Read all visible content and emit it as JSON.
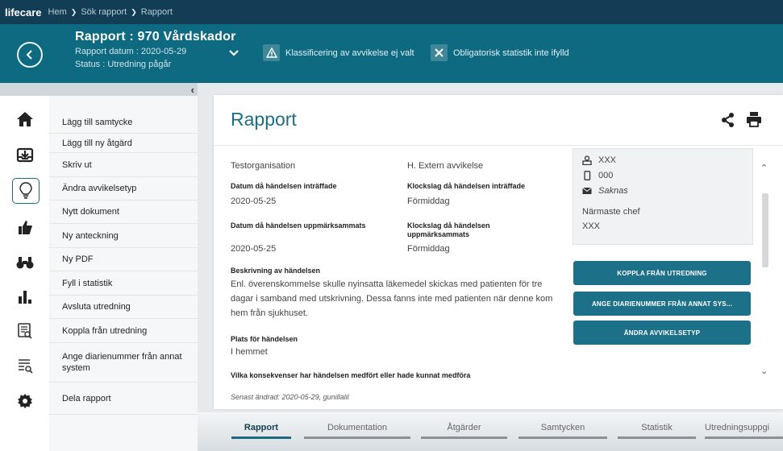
{
  "app": {
    "brand": "lifecare"
  },
  "breadcrumb": [
    "Hem",
    "Sök rapport",
    "Rapport"
  ],
  "header": {
    "title": "Rapport : 970 Vårdskador",
    "date_line": "Rapport datum : 2020-05-29",
    "status_line": "Status : Utredning pågår",
    "warnings": [
      "Klassificering av avvikelse ej valt",
      "Obligatorisk statistik inte ifylld"
    ]
  },
  "sidebar_icons": [
    "home-icon",
    "inbox-icon",
    "lightbulb-icon",
    "thumbs-up-icon",
    "binoculars-icon",
    "bar-chart-icon",
    "calendar-search-icon",
    "list-search-icon",
    "gear-icon"
  ],
  "menu": {
    "collapse_label": "‹",
    "items": [
      "Lägg till samtycke",
      "Lägg till ny åtgärd",
      "Skriv ut",
      "Ändra avvikelsetyp",
      "Nytt dokument",
      "Ny anteckning",
      "Ny PDF",
      "Fyll i statistik",
      "Avsluta utredning",
      "Koppla från utredning",
      "Ange diarienummer från annat system",
      "Dela rapport"
    ]
  },
  "report": {
    "title": "Rapport",
    "organisation": "Testorganisation",
    "category": "H. Extern avvikelse",
    "occurred_date_label": "Datum då händelsen inträffade",
    "occurred_date": "2020-05-25",
    "occurred_time_label": "Klockslag då händelsen inträffade",
    "occurred_time": "Förmiddag",
    "noticed_date_label": "Datum då händelsen uppmärksammats",
    "noticed_date": "2020-05-25",
    "noticed_time_label": "Klockslag då händelsen uppmärksammats",
    "noticed_time": "Förmiddag",
    "description_label": "Beskrivning av händelsen",
    "description": "Enl. överenskommelse skulle nyinsatta läkemedel skickas med patienten för tre dagar i samband med utskrivning.  Dessa fanns inte med patienten när denne kom hem från sjukhuset.",
    "place_label": "Plats för händelsen",
    "place": "I hemmet",
    "consequence_label": "Vilka konsekvenser har händelsen medfört eller hade kunnat medföra",
    "last_edited": "Senast ändrad: 2020-05-29, gunillalil"
  },
  "contact": {
    "name": "XXX",
    "phone": "000",
    "email": "Saknas",
    "manager_label": "Närmaste chef",
    "manager": "XXX"
  },
  "actions": [
    "KOPPLA FRÅN UTREDNING",
    "ANGE DIARIENUMMER FRÅN ANNAT SYS...",
    "ÄNDRA AVVIKELSETYP"
  ],
  "tabs": [
    "Rapport",
    "Dokumentation",
    "Åtgärder",
    "Samtycken",
    "Statistik",
    "Utredningsuppgi"
  ],
  "colors": {
    "topbar": "#123d55",
    "header": "#0e6a80",
    "accent": "#1c7189"
  }
}
